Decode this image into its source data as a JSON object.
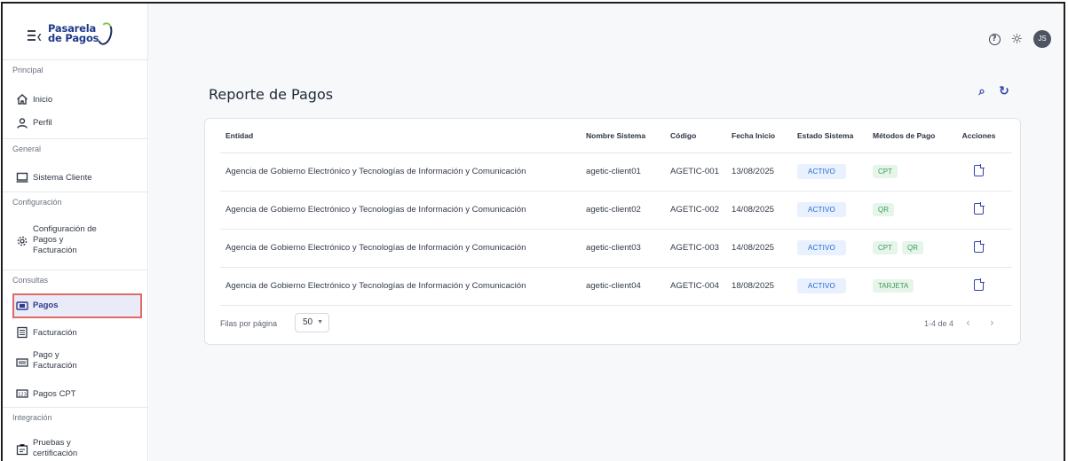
{
  "brand": {
    "line1": "Pasarela",
    "line2": "de Pagos"
  },
  "header": {
    "avatar_initials": "JS",
    "help_icon": "help-circle-icon",
    "theme_icon": "sun-icon"
  },
  "sidebar": {
    "sections": {
      "principal": "Principal",
      "general": "General",
      "configuracion": "Configuración",
      "consultas": "Consultas",
      "integracion": "Integración"
    },
    "items": {
      "inicio": "Inicio",
      "perfil": "Perfil",
      "sistema_cliente": "Sistema Cliente",
      "config_line1": "Configuración de",
      "config_line2": "Pagos y",
      "config_line3": "Facturación",
      "pagos": "Pagos",
      "facturacion": "Facturación",
      "pago_fact_line1": "Pago y",
      "pago_fact_line2": "Facturación",
      "pagos_cpt": "Pagos CPT",
      "pruebas_line1": "Pruebas y",
      "pruebas_line2": "certificación"
    }
  },
  "page": {
    "title": "Reporte de Pagos"
  },
  "table": {
    "headers": {
      "entidad": "Entidad",
      "nombre_sistema": "Nombre Sistema",
      "codigo": "Código",
      "fecha_inicio": "Fecha Inicio",
      "estado_sistema": "Estado Sistema",
      "metodos_pago": "Métodos de Pago",
      "acciones": "Acciones"
    },
    "rows": [
      {
        "entidad": "Agencia de Gobierno Electrónico y Tecnologías de Información y Comunicación",
        "nombre_sistema": "agetic-client01",
        "codigo": "AGETIC-001",
        "fecha_inicio": "13/08/2025",
        "estado": "ACTIVO",
        "metodos": [
          "CPT"
        ]
      },
      {
        "entidad": "Agencia de Gobierno Electrónico y Tecnologías de Información y Comunicación",
        "nombre_sistema": "agetic-client02",
        "codigo": "AGETIC-002",
        "fecha_inicio": "14/08/2025",
        "estado": "ACTIVO",
        "metodos": [
          "QR"
        ]
      },
      {
        "entidad": "Agencia de Gobierno Electrónico y Tecnologías de Información y Comunicación",
        "nombre_sistema": "agetic-client03",
        "codigo": "AGETIC-003",
        "fecha_inicio": "14/08/2025",
        "estado": "ACTIVO",
        "metodos": [
          "CPT",
          "QR"
        ]
      },
      {
        "entidad": "Agencia de Gobierno Electrónico y Tecnologías de Información y Comunicación",
        "nombre_sistema": "agetic-client04",
        "codigo": "AGETIC-004",
        "fecha_inicio": "18/08/2025",
        "estado": "ACTIVO",
        "metodos": [
          "TARJETA"
        ]
      }
    ]
  },
  "pagination": {
    "rows_per_page_label": "Filas por página",
    "rows_per_page": "50",
    "range": "1-4 de 4"
  },
  "colors": {
    "accent": "#3342a8",
    "status_active_bg": "#e8f1fd",
    "method_chip_bg": "#e5f5ea",
    "highlight_border": "#e06a64"
  }
}
